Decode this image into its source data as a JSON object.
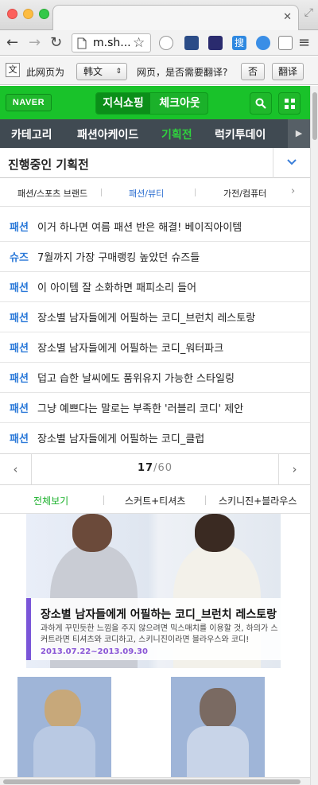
{
  "browser": {
    "url": "m.sh...",
    "translate_prefix": "此网页为",
    "translate_lang": "韩文",
    "translate_question": "网页，是否需要翻译?",
    "btn_no": "否",
    "btn_translate": "翻译"
  },
  "header": {
    "logo": "NAVER",
    "seg_active": "지식쇼핑",
    "seg_other": "체크아웃"
  },
  "nav": {
    "items": [
      "카테고리",
      "패션아케이드",
      "기획전",
      "럭키투데이"
    ],
    "active": "기획전"
  },
  "section": {
    "title": "진행중인 기획전",
    "subtabs": [
      "패션/스포츠 브랜드",
      "패션/뷰티",
      "가전/컴퓨터"
    ],
    "active_subtab": "패션/뷰티"
  },
  "list": [
    {
      "tag": "패션",
      "text": "이거 하나면 여름 패션 반은 해결! 베이직아이템"
    },
    {
      "tag": "슈즈",
      "text": "7월까지 가장 구매랭킹 높았던 슈즈들"
    },
    {
      "tag": "패션",
      "text": "이 아이템 잘 소화하면 패피소리 들어"
    },
    {
      "tag": "패션",
      "text": "장소별 남자들에게 어필하는 코디_브런치 레스토랑"
    },
    {
      "tag": "패션",
      "text": "장소별 남자들에게 어필하는 코디_워터파크"
    },
    {
      "tag": "패션",
      "text": "덥고 습한 날씨에도 품위유지 가능한 스타일링"
    },
    {
      "tag": "패션",
      "text": "그냥 예쁘다는 말로는 부족한 '러블리 코디' 제안"
    },
    {
      "tag": "패션",
      "text": "장소별 남자들에게 어필하는 코디_클럽"
    }
  ],
  "pager": {
    "current": "17",
    "sep": "/",
    "total": "60"
  },
  "filter_tabs": [
    "전체보기",
    "스커트+티셔츠",
    "스키니진+블라우스"
  ],
  "banner": {
    "title": "장소별 남자들에게 어필하는 코디_브런치 레스토랑",
    "desc": "과하게 꾸민듯한 느낌을 주지 않으려면 믹스매치를 이용할 것, 하의가 스커트라면 티셔츠와 코디하고, 스키니진이라면 블라우스와 코디!",
    "date": "2013.07.22~2013.09.30"
  },
  "colors": {
    "naver_green": "#19c22a",
    "accent_blue": "#2b79d8",
    "nav_dark": "#404a52",
    "banner_purple": "#7a55d8"
  }
}
